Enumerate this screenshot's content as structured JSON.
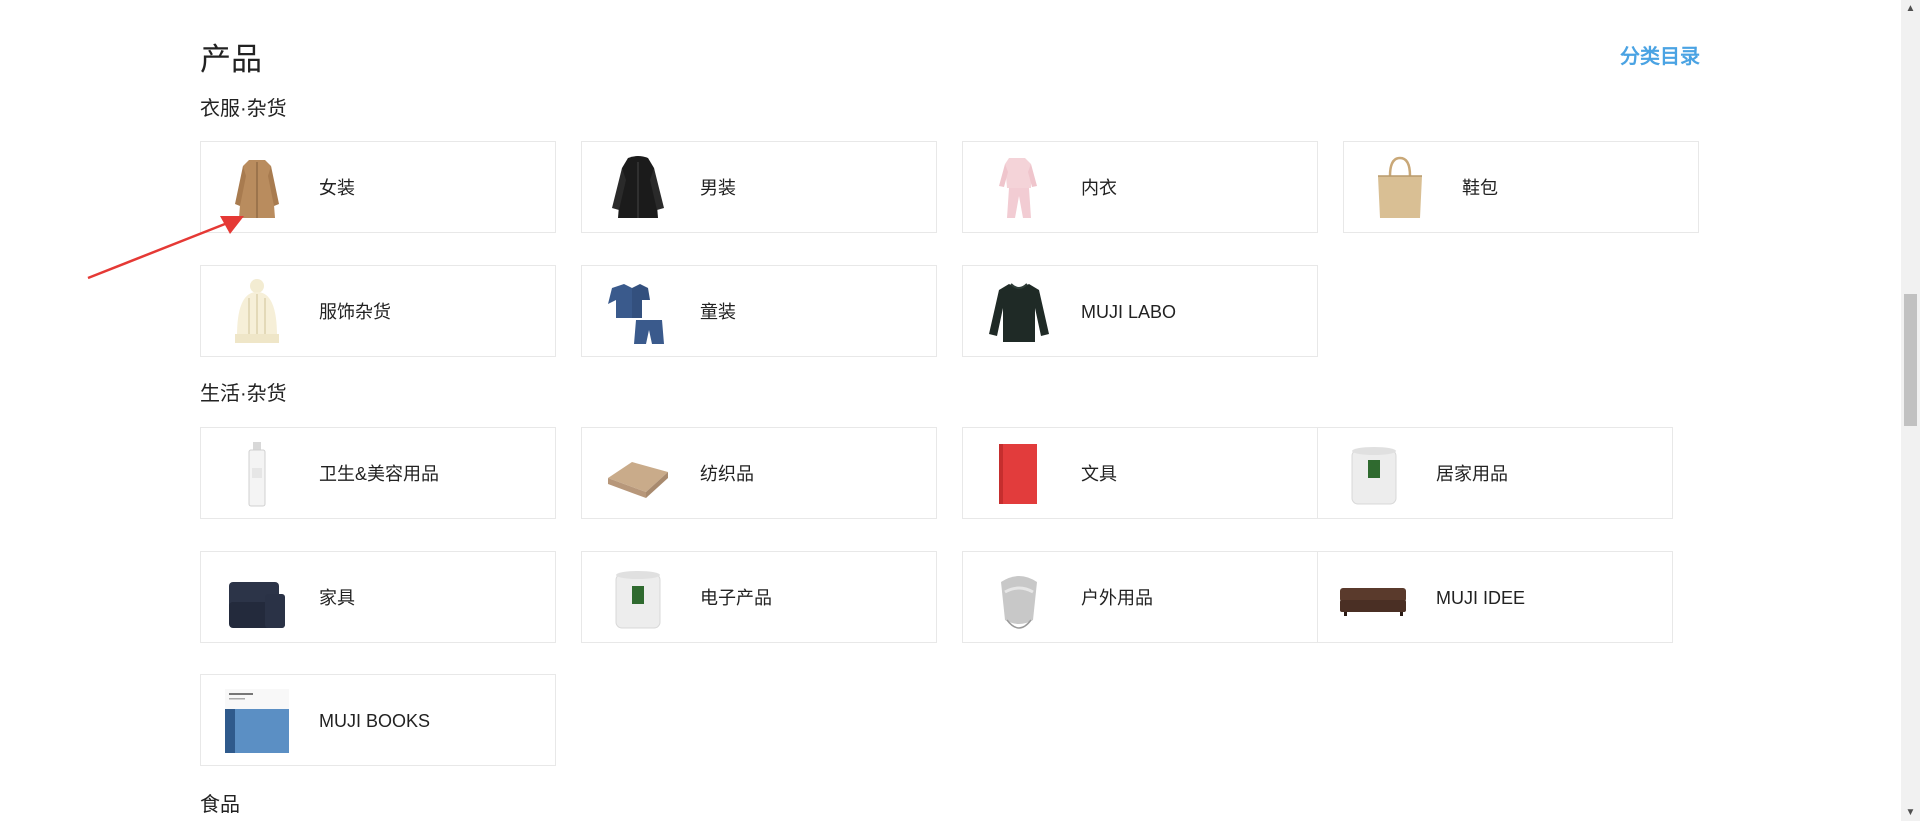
{
  "page": {
    "title": "产品",
    "catalog_link": "分类目录"
  },
  "sections": [
    {
      "title": "衣服·杂货"
    },
    {
      "title": "生活·杂货"
    },
    {
      "title": "食品"
    }
  ],
  "clothing": [
    {
      "label": "女装",
      "icon": "womens-coat-icon"
    },
    {
      "label": "男装",
      "icon": "mens-jacket-icon"
    },
    {
      "label": "内衣",
      "icon": "pajamas-icon"
    },
    {
      "label": "鞋包",
      "icon": "tote-bag-icon"
    },
    {
      "label": "服饰杂货",
      "icon": "knit-hat-icon"
    },
    {
      "label": "童装",
      "icon": "kids-outfit-icon"
    },
    {
      "label": "MUJI LABO",
      "icon": "sweater-icon"
    }
  ],
  "living": [
    {
      "label": "卫生&美容用品",
      "icon": "lotion-bottle-icon"
    },
    {
      "label": "纺织品",
      "icon": "towel-icon"
    },
    {
      "label": "文具",
      "icon": "notebook-icon"
    },
    {
      "label": "居家用品",
      "icon": "candle-icon"
    },
    {
      "label": "家具",
      "icon": "sofa-chair-icon"
    },
    {
      "label": "电子产品",
      "icon": "aroma-diffuser-icon"
    },
    {
      "label": "户外用品",
      "icon": "bucket-icon"
    },
    {
      "label": "MUJI IDEE",
      "icon": "sofa-icon"
    },
    {
      "label": "MUJI BOOKS",
      "icon": "book-icon"
    }
  ],
  "annotation": {
    "color": "#e53935"
  },
  "colors": {
    "accent": "#4aa3e3",
    "card_border": "#e8e8e8"
  }
}
